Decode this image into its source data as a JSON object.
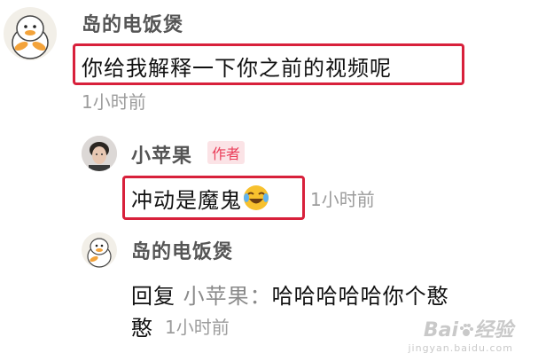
{
  "comment": {
    "author": "岛的电饭煲",
    "text": "你给我解释一下你之前的视频呢",
    "time": "1小时前",
    "avatar_icon": "duck-avatar-icon"
  },
  "reply1": {
    "author": "小苹果",
    "badge": "作者",
    "text": "冲动是魔鬼",
    "emoji": "laughing-crying-emoji-icon",
    "time": "1小时前",
    "avatar_icon": "man-avatar-icon"
  },
  "reply2": {
    "author": "岛的电饭煲",
    "prefix": "回复",
    "target": "小苹果：",
    "text_line1": "哈哈哈哈哈你个憨",
    "text_line2": "憨",
    "time": "1小时前",
    "avatar_icon": "duck-avatar-icon"
  },
  "watermark": {
    "brand_prefix": "Bai",
    "brand_suffix": "经验",
    "url": "jingyan.baidu.com"
  },
  "colors": {
    "highlight": "#d8203b",
    "badge_text": "#ea3e5a",
    "badge_bg": "#fbe3e6",
    "time_text": "#9c9c9c"
  }
}
